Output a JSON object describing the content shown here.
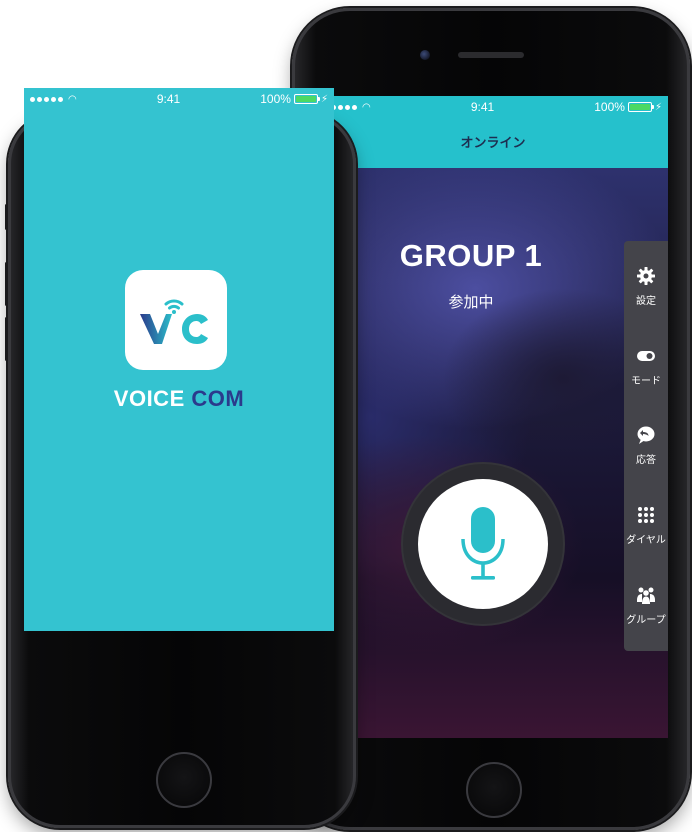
{
  "front_phone": {
    "status_bar": {
      "time": "9:41",
      "battery": "100%"
    },
    "app_name_part1": "VOICE",
    "app_name_part2": "COM",
    "logo_text": "VC"
  },
  "back_phone": {
    "status_bar": {
      "time": "9:41",
      "battery": "100%"
    },
    "header_title": "オンライン",
    "group_name": "GROUP 1",
    "group_status": "参加中",
    "side_menu": [
      {
        "label": "設定",
        "icon": "gear-icon"
      },
      {
        "label": "モード",
        "icon": "toggle-icon"
      },
      {
        "label": "応答",
        "icon": "reply-bubble-icon"
      },
      {
        "label": "ダイヤル",
        "icon": "dialpad-icon"
      },
      {
        "label": "グループ",
        "icon": "group-icon"
      }
    ],
    "mic_icon": "microphone-icon"
  },
  "colors": {
    "splash_background": "#34c3d0",
    "header_background": "#25c1cc",
    "accent_mic": "#2bbfca",
    "logo_navy": "#2b3a8c",
    "battery_green": "#4cd964"
  }
}
